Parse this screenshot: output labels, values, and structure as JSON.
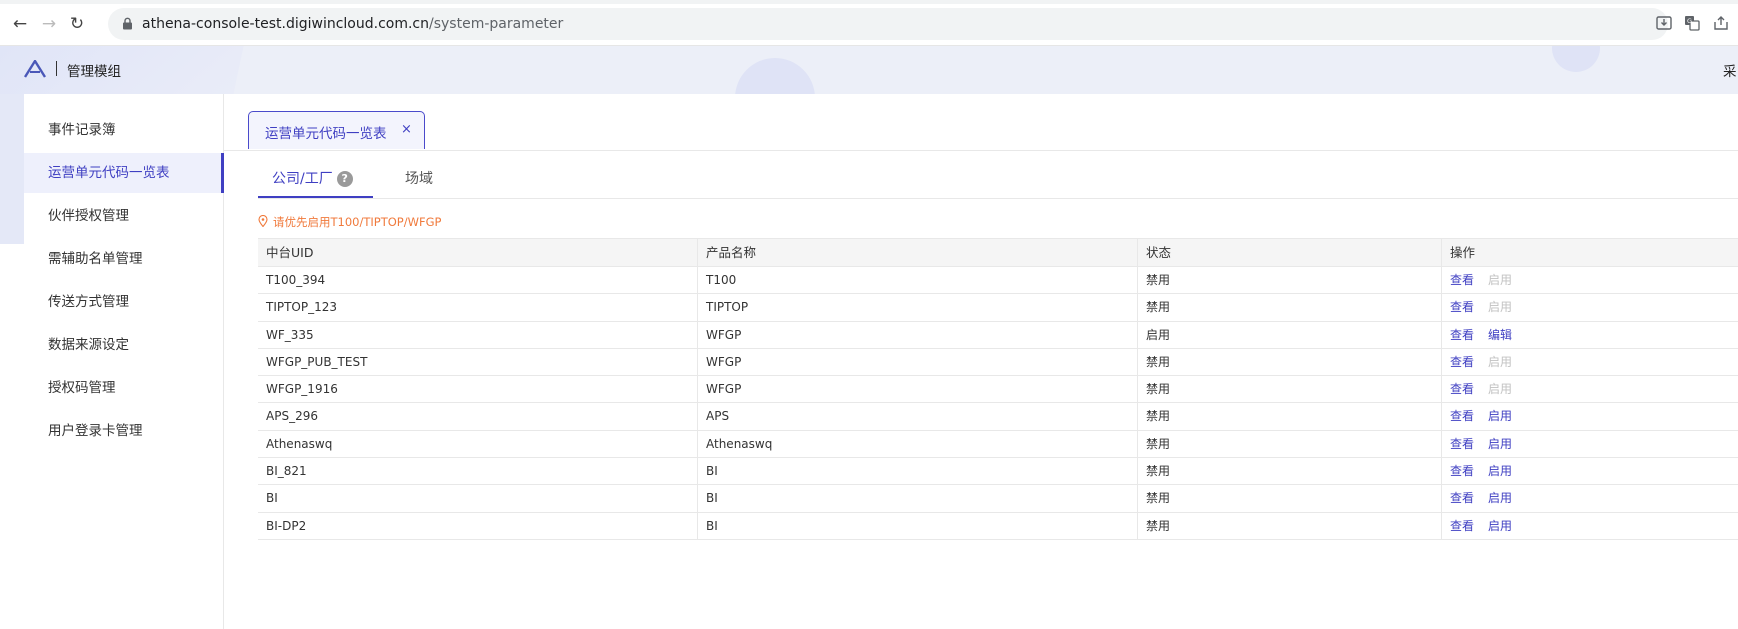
{
  "browser": {
    "url_host": "athena-console-test.digiwincloud.com.cn",
    "url_path": "/system-parameter"
  },
  "header": {
    "title": "管理模组",
    "right_text": "采"
  },
  "sidebar": {
    "items": [
      {
        "label": "事件记录簿"
      },
      {
        "label": "运营单元代码一览表"
      },
      {
        "label": "伙伴授权管理"
      },
      {
        "label": "需辅助名单管理"
      },
      {
        "label": "传送方式管理"
      },
      {
        "label": "数据来源设定"
      },
      {
        "label": "授权码管理"
      },
      {
        "label": "用户登录卡管理"
      }
    ],
    "active_index": 1
  },
  "page_tab": {
    "label": "运营单元代码一览表",
    "close": "×"
  },
  "sub_tabs": {
    "company_label": "公司/工厂",
    "help": "?",
    "site_label": "场域"
  },
  "hint": "请优先启用T100/TIPTOP/WFGP",
  "table": {
    "headers": {
      "uid": "中台UID",
      "product": "产品名称",
      "status": "状态",
      "actions": "操作"
    },
    "rows": [
      {
        "uid": "T100_394",
        "product": "T100",
        "status": "禁用",
        "view": "查看",
        "action": "启用",
        "action_enabled": false
      },
      {
        "uid": "TIPTOP_123",
        "product": "TIPTOP",
        "status": "禁用",
        "view": "查看",
        "action": "启用",
        "action_enabled": false
      },
      {
        "uid": "WF_335",
        "product": "WFGP",
        "status": "启用",
        "view": "查看",
        "action": "编辑",
        "action_enabled": true
      },
      {
        "uid": "WFGP_PUB_TEST",
        "product": "WFGP",
        "status": "禁用",
        "view": "查看",
        "action": "启用",
        "action_enabled": false
      },
      {
        "uid": "WFGP_1916",
        "product": "WFGP",
        "status": "禁用",
        "view": "查看",
        "action": "启用",
        "action_enabled": false
      },
      {
        "uid": "APS_296",
        "product": "APS",
        "status": "禁用",
        "view": "查看",
        "action": "启用",
        "action_enabled": true
      },
      {
        "uid": "Athenaswq",
        "product": "Athenaswq",
        "status": "禁用",
        "view": "查看",
        "action": "启用",
        "action_enabled": true
      },
      {
        "uid": "BI_821",
        "product": "BI",
        "status": "禁用",
        "view": "查看",
        "action": "启用",
        "action_enabled": true
      },
      {
        "uid": "BI",
        "product": "BI",
        "status": "禁用",
        "view": "查看",
        "action": "启用",
        "action_enabled": true
      },
      {
        "uid": "BI-DP2",
        "product": "BI",
        "status": "禁用",
        "view": "查看",
        "action": "启用",
        "action_enabled": true
      }
    ]
  },
  "colors": {
    "accent": "#3f3fc2",
    "hint": "#f07a3c",
    "disabled_action": "#c2c2c2"
  }
}
